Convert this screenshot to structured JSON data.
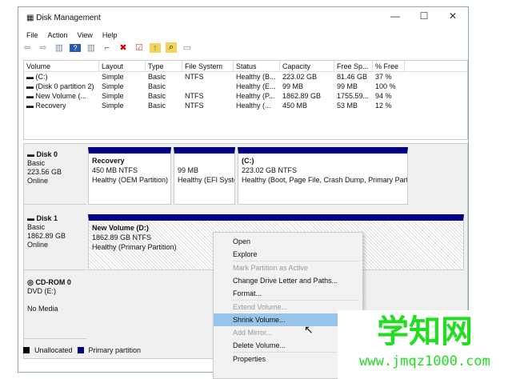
{
  "window": {
    "title": "Disk Management",
    "controls": [
      "—",
      "☐",
      "✕"
    ]
  },
  "menu": [
    "File",
    "Action",
    "View",
    "Help"
  ],
  "toolbar": [
    "⇦",
    "⇨",
    "▥",
    "?",
    "▥",
    "⌐",
    "✖",
    "☑",
    "↑",
    "⌕",
    "▭"
  ],
  "columns": [
    "Volume",
    "Layout",
    "Type",
    "File System",
    "Status",
    "Capacity",
    "Free Sp...",
    "% Free"
  ],
  "volumes": [
    [
      "(C:)",
      "Simple",
      "Basic",
      "NTFS",
      "Healthy (B...",
      "223.02 GB",
      "81.46 GB",
      "37 %"
    ],
    [
      "(Disk 0 partition 2)",
      "Simple",
      "Basic",
      "",
      "Healthy (E...",
      "99 MB",
      "99 MB",
      "100 %"
    ],
    [
      "New Volume (...",
      "Simple",
      "Basic",
      "NTFS",
      "Healthy (P...",
      "1862.89 GB",
      "1755.59...",
      "94 %"
    ],
    [
      "Recovery",
      "Simple",
      "Basic",
      "NTFS",
      "Healthy (...",
      "450 MB",
      "53 MB",
      "12 %"
    ]
  ],
  "disks": [
    {
      "name": "Disk 0",
      "type": "Basic",
      "size": "223.56 GB",
      "status": "Online",
      "partitions": [
        {
          "name": "Recovery",
          "size": "450 MB NTFS",
          "status": "Healthy (OEM Partition)"
        },
        {
          "name": "",
          "size": "99 MB",
          "status": "Healthy (EFI Syste"
        },
        {
          "name": "(C:)",
          "size": "223.02 GB NTFS",
          "status": "Healthy (Boot, Page File, Crash Dump, Primary Partit"
        }
      ]
    },
    {
      "name": "Disk 1",
      "type": "Basic",
      "size": "1862.89 GB",
      "status": "Online",
      "partitions": [
        {
          "name": "New Volume  (D:)",
          "size": "1862.89 GB NTFS",
          "status": "Healthy (Primary Partition)"
        }
      ]
    },
    {
      "name": "CD-ROM 0",
      "type": "DVD (E:)",
      "size": "",
      "status": "No Media"
    }
  ],
  "legend": [
    "Unallocated",
    "Primary partition"
  ],
  "colors": {
    "primary": "#000080",
    "unallocated": "#000000",
    "highlight": "#99c4ea"
  },
  "context_menu": [
    "Open",
    "Explore",
    "Mark Partition as Active",
    "Change Drive Letter and Paths...",
    "Format...",
    "Extend Volume...",
    "Shrink Volume...",
    "Add Mirror...",
    "Delete Volume...",
    "Properties"
  ],
  "watermark": {
    "title": "学知网",
    "url": "www.jmqz1000.com"
  }
}
